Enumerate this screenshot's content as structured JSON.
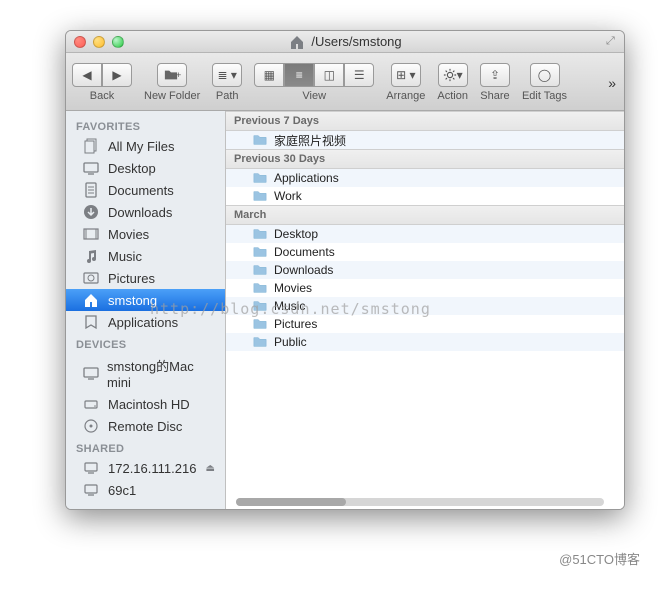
{
  "window": {
    "path_prefix_icon": "home-icon",
    "path": "/Users/smstong"
  },
  "toolbar": {
    "back_label": "Back",
    "newfolder_label": "New Folder",
    "path_label": "Path",
    "view_label": "View",
    "arrange_label": "Arrange",
    "action_label": "Action",
    "share_label": "Share",
    "edittags_label": "Edit Tags"
  },
  "sidebar": {
    "sections": [
      {
        "header": "FAVORITES",
        "items": [
          {
            "icon": "all-my-files-icon",
            "label": "All My Files"
          },
          {
            "icon": "desktop-icon",
            "label": "Desktop"
          },
          {
            "icon": "documents-icon",
            "label": "Documents"
          },
          {
            "icon": "downloads-icon",
            "label": "Downloads"
          },
          {
            "icon": "movies-icon",
            "label": "Movies"
          },
          {
            "icon": "music-icon",
            "label": "Music"
          },
          {
            "icon": "pictures-icon",
            "label": "Pictures"
          },
          {
            "icon": "home-icon",
            "label": "smstong",
            "selected": true
          },
          {
            "icon": "applications-icon",
            "label": "Applications"
          }
        ]
      },
      {
        "header": "DEVICES",
        "items": [
          {
            "icon": "imac-icon",
            "label": "smstong的Mac mini"
          },
          {
            "icon": "hdd-icon",
            "label": "Macintosh HD"
          },
          {
            "icon": "disc-icon",
            "label": "Remote Disc"
          }
        ]
      },
      {
        "header": "SHARED",
        "items": [
          {
            "icon": "server-icon",
            "label": "172.16.111.216",
            "eject": true
          },
          {
            "icon": "server-icon",
            "label": "69c1"
          }
        ]
      }
    ]
  },
  "content": {
    "groups": [
      {
        "header": "Previous 7 Days",
        "rows": [
          {
            "icon": "folder-icon",
            "name": "家庭照片视频"
          }
        ]
      },
      {
        "header": "Previous 30 Days",
        "rows": [
          {
            "icon": "folder-icon",
            "name": "Applications"
          },
          {
            "icon": "folder-icon",
            "name": "Work"
          }
        ]
      },
      {
        "header": "March",
        "rows": [
          {
            "icon": "folder-icon",
            "name": "Desktop"
          },
          {
            "icon": "folder-icon",
            "name": "Documents"
          },
          {
            "icon": "folder-icon",
            "name": "Downloads"
          },
          {
            "icon": "folder-icon",
            "name": "Movies"
          },
          {
            "icon": "folder-icon",
            "name": "Music"
          },
          {
            "icon": "folder-icon",
            "name": "Pictures"
          },
          {
            "icon": "folder-icon",
            "name": "Public"
          }
        ]
      }
    ]
  },
  "watermark": "http://blog.csdn.net/smstong",
  "credit": "@51CTO博客"
}
